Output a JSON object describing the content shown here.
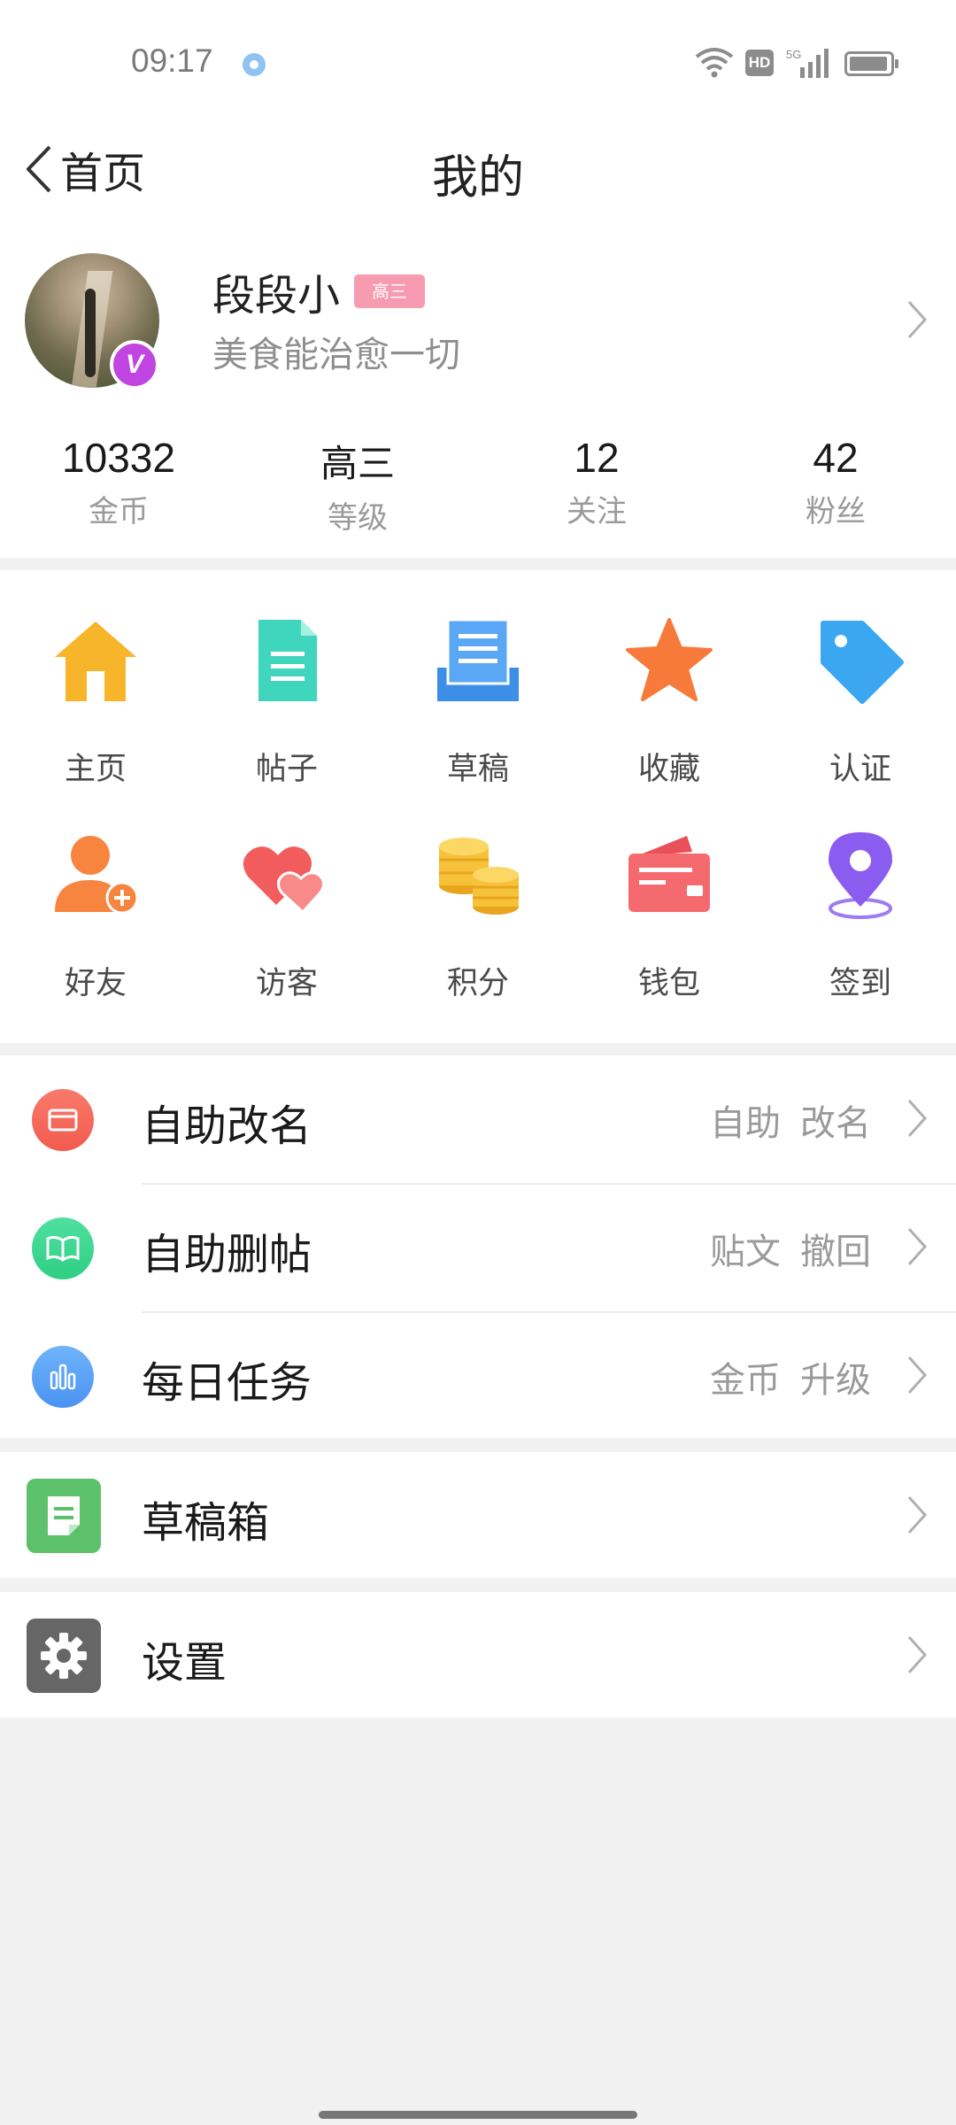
{
  "status_bar": {
    "time": "09:17",
    "hd": "HD",
    "network": "5G"
  },
  "header": {
    "back_label": "首页",
    "title": "我的"
  },
  "profile": {
    "username": "段段小",
    "level_tag": "高三",
    "bio": "美食能治愈一切",
    "vip_badge": "V"
  },
  "stats": [
    {
      "value": "10332",
      "label": "金币"
    },
    {
      "value": "高三",
      "label": "等级"
    },
    {
      "value": "12",
      "label": "关注"
    },
    {
      "value": "42",
      "label": "粉丝"
    }
  ],
  "grid": [
    {
      "label": "主页",
      "icon": "home-icon"
    },
    {
      "label": "帖子",
      "icon": "document-icon"
    },
    {
      "label": "草稿",
      "icon": "draft-tray-icon"
    },
    {
      "label": "收藏",
      "icon": "star-icon"
    },
    {
      "label": "认证",
      "icon": "tag-icon"
    },
    {
      "label": "好友",
      "icon": "add-friend-icon"
    },
    {
      "label": "访客",
      "icon": "hearts-icon"
    },
    {
      "label": "积分",
      "icon": "coins-icon"
    },
    {
      "label": "钱包",
      "icon": "wallet-icon"
    },
    {
      "label": "签到",
      "icon": "location-pin-icon"
    }
  ],
  "list_group1": [
    {
      "title": "自助改名",
      "tags": [
        "自助",
        "改名"
      ],
      "icon": "card-icon",
      "color": "#f26b5b"
    },
    {
      "title": "自助删帖",
      "tags": [
        "贴文",
        "撤回"
      ],
      "icon": "book-icon",
      "color": "#3dd68c"
    },
    {
      "title": "每日任务",
      "tags": [
        "金币",
        "升级"
      ],
      "icon": "bar-chart-icon",
      "color": "#5aa2f5"
    }
  ],
  "list_drafts": {
    "title": "草稿箱",
    "icon": "draft-box-icon",
    "color": "#5cc16a"
  },
  "list_settings": {
    "title": "设置",
    "icon": "gear-icon",
    "color": "#666666"
  }
}
